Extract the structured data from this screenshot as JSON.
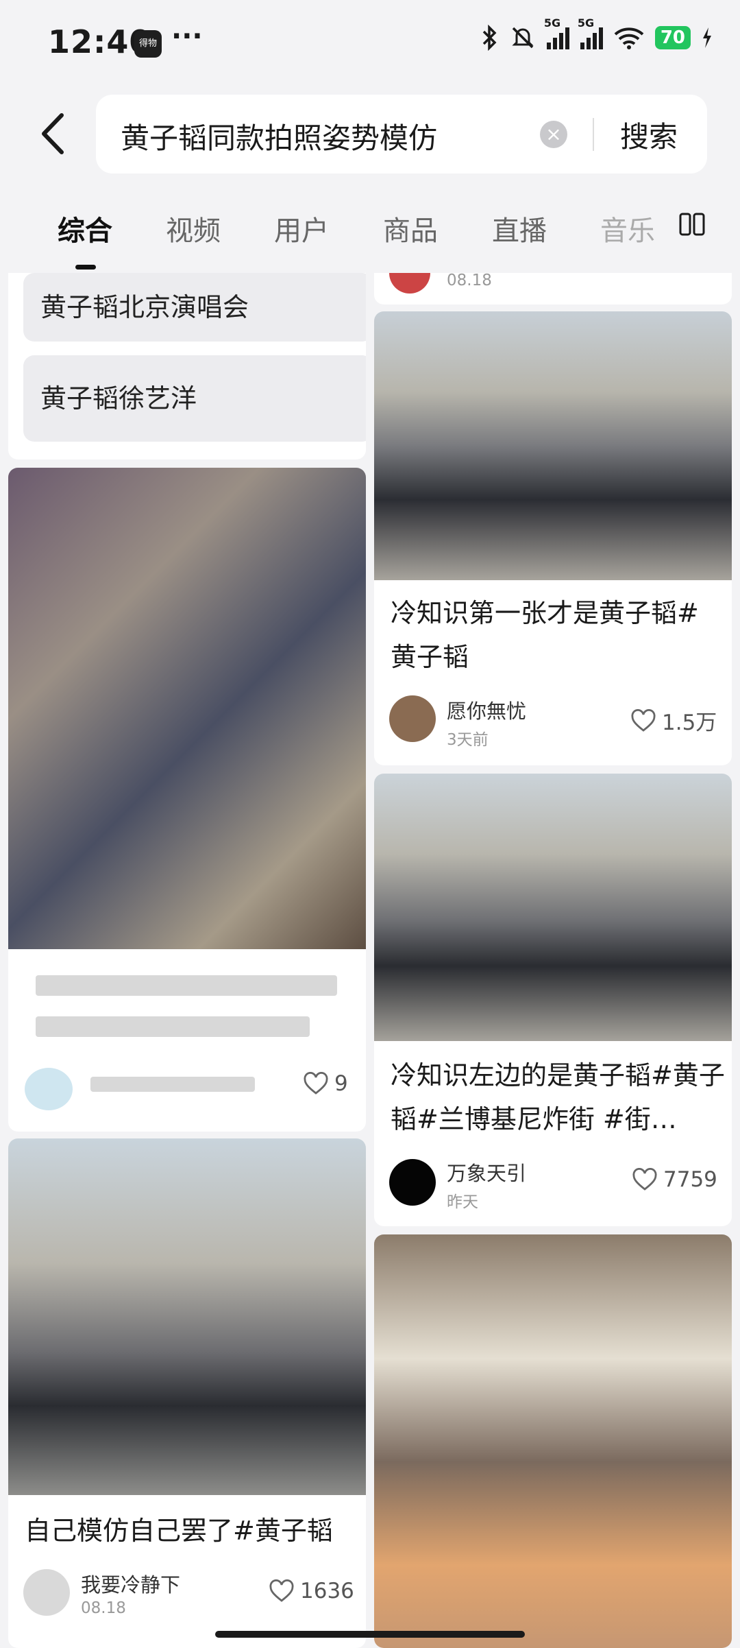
{
  "status_bar": {
    "time": "12:40",
    "app_badge": "得物",
    "more": "···",
    "network": "5G",
    "battery": "70"
  },
  "search": {
    "query": "黄子韬同款拍照姿势模仿",
    "clear_symbol": "×",
    "button": "搜索"
  },
  "tabs": [
    "综合",
    "视频",
    "用户",
    "商品",
    "直播",
    "音乐"
  ],
  "suggestions": [
    "黄子韬北京演唱会",
    "黄子韬徐艺洋"
  ],
  "top_fragment": {
    "date": "08.18"
  },
  "posts": [
    {
      "title": "冷知识第一张才是黄子韬#黄子韬",
      "author": "愿你無忧",
      "time": "3天前",
      "likes": "1.5万"
    },
    {
      "title": "冷知识左边的是黄子韬#黄子韬#兰博基尼炸街 #街…",
      "author": "万象天引",
      "time": "昨天",
      "likes": "7759"
    },
    {
      "likes": "9"
    },
    {
      "title": "自己模仿自己罢了#黄子韬",
      "author": "我要冷静下",
      "time": "08.18",
      "likes": "1636"
    }
  ],
  "colors": {
    "accent": "#111111",
    "background": "#f3f3f5",
    "battery": "#22c55e"
  }
}
